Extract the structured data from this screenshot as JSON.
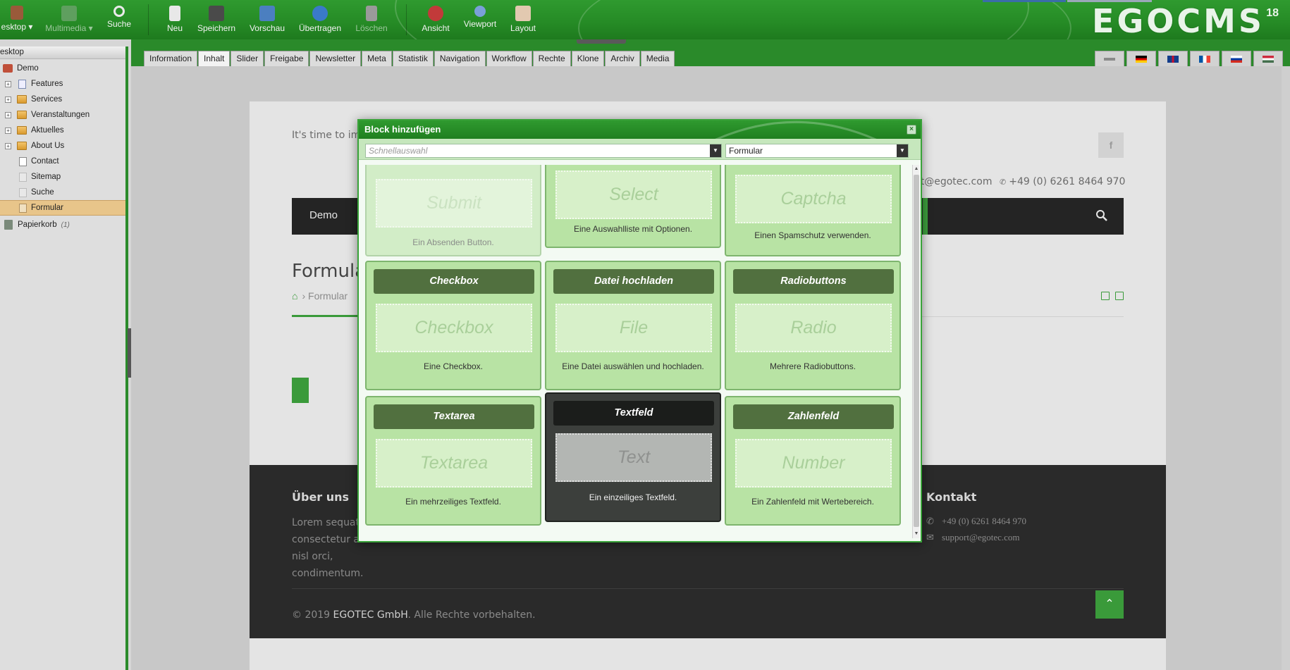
{
  "toolbar": {
    "items": [
      {
        "label": "esktop ▾",
        "icon": "home-icon",
        "disabled": false
      },
      {
        "label": "Multimedia ▾",
        "icon": "film-icon",
        "disabled": true
      },
      {
        "label": "Suche",
        "icon": "magnifier-icon",
        "disabled": false
      },
      {
        "label": "Neu",
        "icon": "new-page-icon",
        "disabled": false
      },
      {
        "label": "Speichern",
        "icon": "floppy-disk-icon",
        "disabled": false
      },
      {
        "label": "Vorschau",
        "icon": "monitor-icon",
        "disabled": false
      },
      {
        "label": "Übertragen",
        "icon": "globe-transfer-icon",
        "disabled": false
      },
      {
        "label": "Löschen",
        "icon": "trash-can-icon",
        "disabled": true
      },
      {
        "label": "Ansicht",
        "icon": "view-stop-icon",
        "disabled": false
      },
      {
        "label": "Viewport",
        "icon": "viewport-globe-icon",
        "disabled": false
      },
      {
        "label": "Layout",
        "icon": "layout-icon",
        "disabled": false
      }
    ],
    "logo": "EGOCMS",
    "logo_version": "18"
  },
  "sidebar": {
    "header": "esktop",
    "root": "Demo",
    "items": [
      {
        "label": "Features",
        "type": "folder"
      },
      {
        "label": "Services",
        "type": "folder"
      },
      {
        "label": "Veranstaltungen",
        "type": "folder"
      },
      {
        "label": "Aktuelles",
        "type": "folder"
      },
      {
        "label": "About Us",
        "type": "folder"
      },
      {
        "label": "Contact",
        "type": "page"
      },
      {
        "label": "Sitemap",
        "type": "page"
      },
      {
        "label": "Suche",
        "type": "page"
      },
      {
        "label": "Formular",
        "type": "page",
        "selected": true
      }
    ],
    "trash": {
      "label": "Papierkorb",
      "count": "(1)"
    }
  },
  "tabs": [
    "Information",
    "Inhalt",
    "Slider",
    "Freigabe",
    "Newsletter",
    "Meta",
    "Statistik",
    "Navigation",
    "Workflow",
    "Rechte",
    "Klone",
    "Archiv",
    "Media"
  ],
  "active_tab": "Inhalt",
  "site": {
    "topline": "It's time to imp",
    "fb": "f",
    "email": "rt@egotec.com",
    "phone": "+49 (0) 6261 8464 970",
    "nav_demo": "Demo",
    "title": "Formula",
    "breadcrumb": "Formular",
    "footer": {
      "about_title": "Über uns",
      "about_text": "Lorem sequat consectetur ac nisl orci, condimentum.",
      "contact_title": "Kontakt",
      "contact_phone": "+49 (0) 6261 8464 970",
      "contact_email": "support@egotec.com",
      "copyright_prefix": "© 2019",
      "copyright_company": "EGOTEC GmbH",
      "copyright_suffix": ". Alle Rechte vorbehalten."
    }
  },
  "dialog": {
    "title": "Block hinzufügen",
    "quick_placeholder": "Schnellauswahl",
    "category": "Formular",
    "blocks": [
      {
        "title": "",
        "preview": "Submit",
        "desc": "Ein Absenden Button."
      },
      {
        "title": "",
        "preview": "Select",
        "desc": "Eine Auswahlliste mit Optionen."
      },
      {
        "title": "",
        "preview": "Captcha",
        "desc": "Einen Spamschutz verwenden."
      },
      {
        "title": "Checkbox",
        "preview": "Checkbox",
        "desc": "Eine Checkbox."
      },
      {
        "title": "Datei hochladen",
        "preview": "File",
        "desc": "Eine Datei auswählen und hochladen."
      },
      {
        "title": "Radiobuttons",
        "preview": "Radio",
        "desc": "Mehrere Radiobuttons."
      },
      {
        "title": "Textarea",
        "preview": "Textarea",
        "desc": "Ein mehrzeiliges Textfeld."
      },
      {
        "title": "Textfeld",
        "preview": "Text",
        "desc": "Ein einzeiliges Textfeld."
      },
      {
        "title": "Zahlenfeld",
        "preview": "Number",
        "desc": "Ein Zahlenfeld mit Wertebereich."
      }
    ]
  },
  "colors": {
    "brand_green": "#2a8a2a",
    "card_green": "#b8e3a4",
    "card_header": "#51703f",
    "selected_card": "#3c3f3c"
  }
}
